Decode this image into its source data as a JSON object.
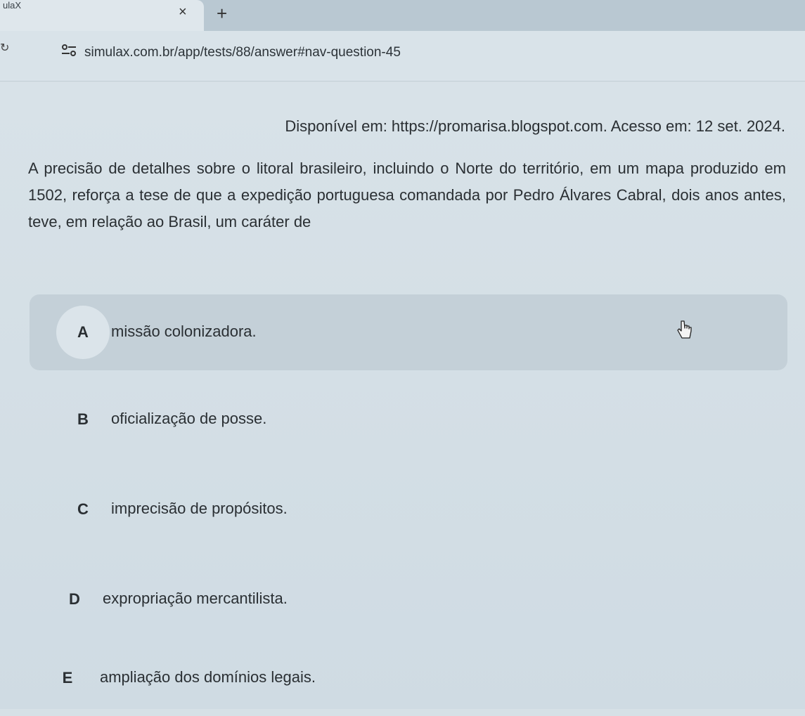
{
  "browser": {
    "tab_title": "ulaX",
    "tab_close": "×",
    "new_tab": "+",
    "url": "simulax.com.br/app/tests/88/answer#nav-question-45"
  },
  "question": {
    "source": "Disponível em: https://promarisa.blogspot.com. Acesso em: 12 set. 2024.",
    "text": "A precisão de detalhes sobre o litoral brasileiro, incluindo o Norte do território, em um mapa produzido em 1502, reforça a tese de que a expedição portuguesa comandada por Pedro Álvares Cabral, dois anos antes, teve, em relação ao Brasil, um caráter de",
    "options": [
      {
        "letter": "A",
        "text": "missão colonizadora."
      },
      {
        "letter": "B",
        "text": "oficialização de posse."
      },
      {
        "letter": "C",
        "text": "imprecisão de propósitos."
      },
      {
        "letter": "D",
        "text": "expropriação mercantilista."
      },
      {
        "letter": "E",
        "text": "ampliação dos domínios legais."
      }
    ]
  },
  "colors": {
    "page_background": "#d6e0e6",
    "hover_background": "#c4d0d8",
    "text": "#2a2f33"
  }
}
